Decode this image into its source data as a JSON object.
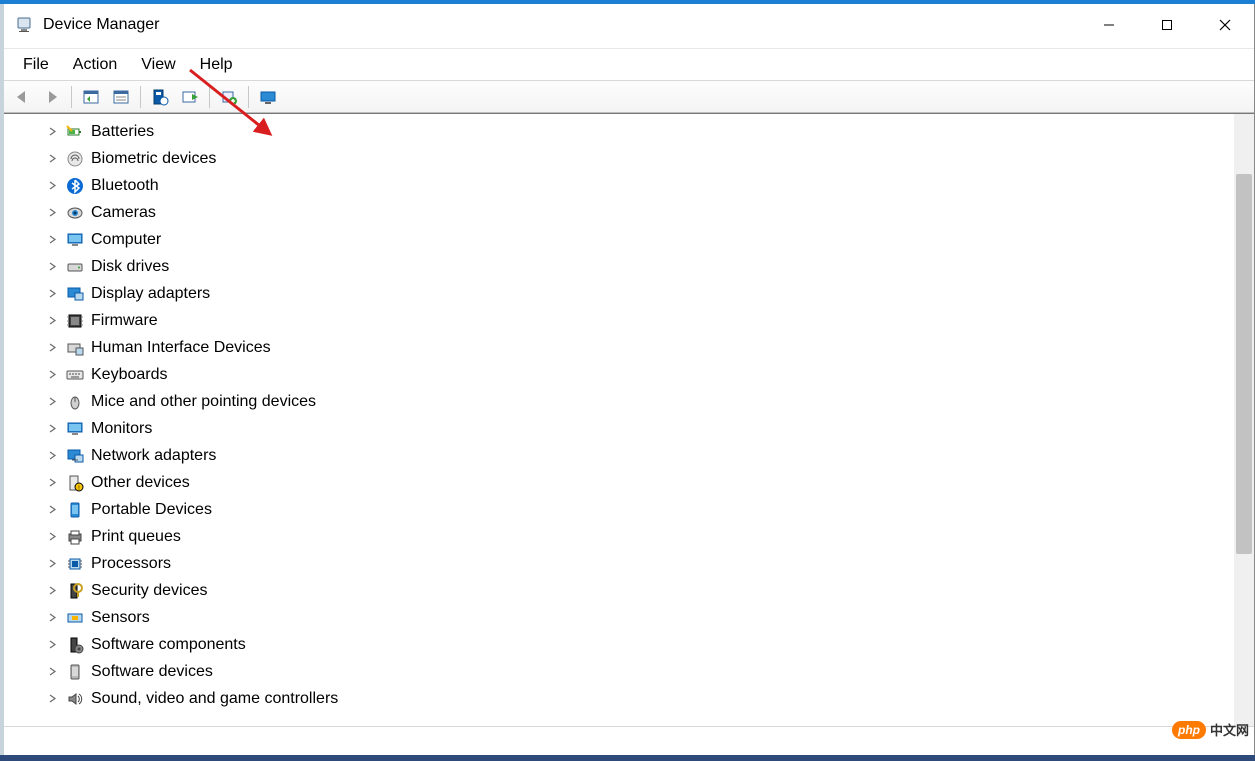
{
  "window": {
    "title": "Device Manager"
  },
  "menubar": {
    "items": [
      "File",
      "Action",
      "View",
      "Help"
    ]
  },
  "toolbar": {
    "buttons": [
      {
        "name": "back-icon"
      },
      {
        "name": "forward-icon"
      },
      {
        "name": "sep"
      },
      {
        "name": "show-hidden-icon"
      },
      {
        "name": "properties-icon"
      },
      {
        "name": "sep"
      },
      {
        "name": "update-driver-icon"
      },
      {
        "name": "enable-device-icon"
      },
      {
        "name": "sep"
      },
      {
        "name": "uninstall-device-icon"
      },
      {
        "name": "sep"
      },
      {
        "name": "scan-hardware-icon"
      }
    ]
  },
  "tree": {
    "items": [
      {
        "label": "Batteries",
        "icon": "battery-icon"
      },
      {
        "label": "Biometric devices",
        "icon": "fingerprint-icon"
      },
      {
        "label": "Bluetooth",
        "icon": "bluetooth-icon"
      },
      {
        "label": "Cameras",
        "icon": "camera-icon"
      },
      {
        "label": "Computer",
        "icon": "computer-icon"
      },
      {
        "label": "Disk drives",
        "icon": "disk-icon"
      },
      {
        "label": "Display adapters",
        "icon": "display-adapter-icon"
      },
      {
        "label": "Firmware",
        "icon": "firmware-icon"
      },
      {
        "label": "Human Interface Devices",
        "icon": "hid-icon"
      },
      {
        "label": "Keyboards",
        "icon": "keyboard-icon"
      },
      {
        "label": "Mice and other pointing devices",
        "icon": "mouse-icon"
      },
      {
        "label": "Monitors",
        "icon": "monitor-icon"
      },
      {
        "label": "Network adapters",
        "icon": "network-icon"
      },
      {
        "label": "Other devices",
        "icon": "other-device-icon"
      },
      {
        "label": "Portable Devices",
        "icon": "portable-icon"
      },
      {
        "label": "Print queues",
        "icon": "printer-icon"
      },
      {
        "label": "Processors",
        "icon": "processor-icon"
      },
      {
        "label": "Security devices",
        "icon": "security-icon"
      },
      {
        "label": "Sensors",
        "icon": "sensor-icon"
      },
      {
        "label": "Software components",
        "icon": "software-component-icon"
      },
      {
        "label": "Software devices",
        "icon": "software-device-icon"
      },
      {
        "label": "Sound, video and game controllers",
        "icon": "sound-icon"
      }
    ]
  },
  "watermark": {
    "badge": "php",
    "text": "中文网"
  }
}
